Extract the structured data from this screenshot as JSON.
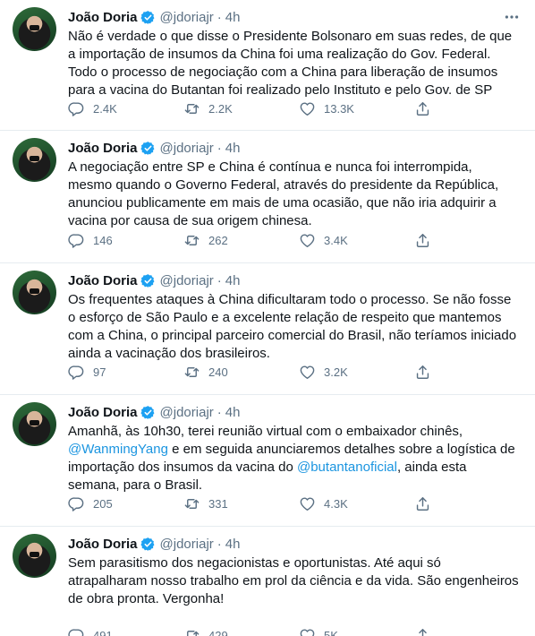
{
  "author": {
    "name": "João Doria",
    "handle": "@jdoriajr",
    "separator": "·",
    "time": "4h"
  },
  "tweets": [
    {
      "text": "Não é verdade o que disse o Presidente Bolsonaro em suas redes, de que a importação de insumos da China foi uma realização do Gov. Federal. Todo o processo de negociação com a China para liberação de insumos para a vacina do Butantan foi realizado pelo Instituto e pelo Gov. de SP",
      "replies": "2.4K",
      "retweets": "2.2K",
      "likes": "13.3K"
    },
    {
      "text": "A negociação entre SP e China é contínua e nunca foi interrompida, mesmo quando o Governo Federal, através do presidente da República, anunciou publicamente em mais de uma ocasião, que não iria adquirir a vacina por causa de sua origem chinesa.",
      "replies": "146",
      "retweets": "262",
      "likes": "3.4K"
    },
    {
      "text": "Os frequentes ataques à China dificultaram todo o processo. Se não fosse o esforço de São Paulo e a excelente relação de respeito que mantemos com a China, o principal parceiro comercial do Brasil, não teríamos iniciado ainda a vacinação dos brasileiros.",
      "replies": "97",
      "retweets": "240",
      "likes": "3.2K"
    },
    {
      "text_part1": "Amanhã, às 10h30, terei reunião virtual com o embaixador chinês,",
      "mention1": "@WanmingYang",
      "text_part2": " e em seguida anunciaremos detalhes sobre a logística de importação dos insumos da vacina do ",
      "mention2": "@butantanoficial",
      "text_part3": ", ainda esta semana, para o Brasil.",
      "replies": "205",
      "retweets": "331",
      "likes": "4.3K"
    },
    {
      "text": "Sem parasitismo dos negacionistas e oportunistas. Até aqui só atrapalharam nosso trabalho em prol da ciência e da vida. São engenheiros de obra pronta. Vergonha!",
      "replies": "491",
      "retweets": "429",
      "likes": "5K"
    }
  ],
  "colors": {
    "text": "#0f1419",
    "secondary": "#5b7083",
    "link": "#1b95e0",
    "verified": "#1da1f2",
    "divider": "#e6ecf0"
  }
}
